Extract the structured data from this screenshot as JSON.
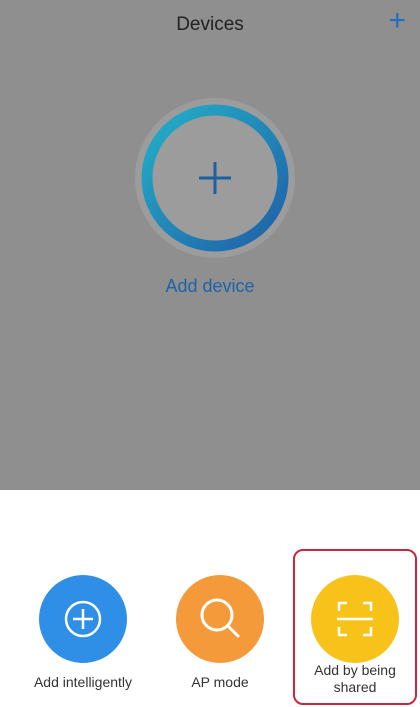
{
  "header": {
    "title": "Devices",
    "add_icon": "plus-icon"
  },
  "main": {
    "add_device_label": "Add device",
    "add_device_icon": "plus-icon"
  },
  "options": [
    {
      "label": "Add intelligently",
      "icon": "plus-circle-icon",
      "color": "#2f8fe6"
    },
    {
      "label": "AP mode",
      "icon": "search-icon",
      "color": "#f59a3b"
    },
    {
      "label_line1": "Add by being",
      "label_line2": "shared",
      "icon": "scan-icon",
      "color": "#f7c31b"
    }
  ],
  "colors": {
    "accent": "#1f6fbf",
    "highlight": "#c8283a"
  }
}
